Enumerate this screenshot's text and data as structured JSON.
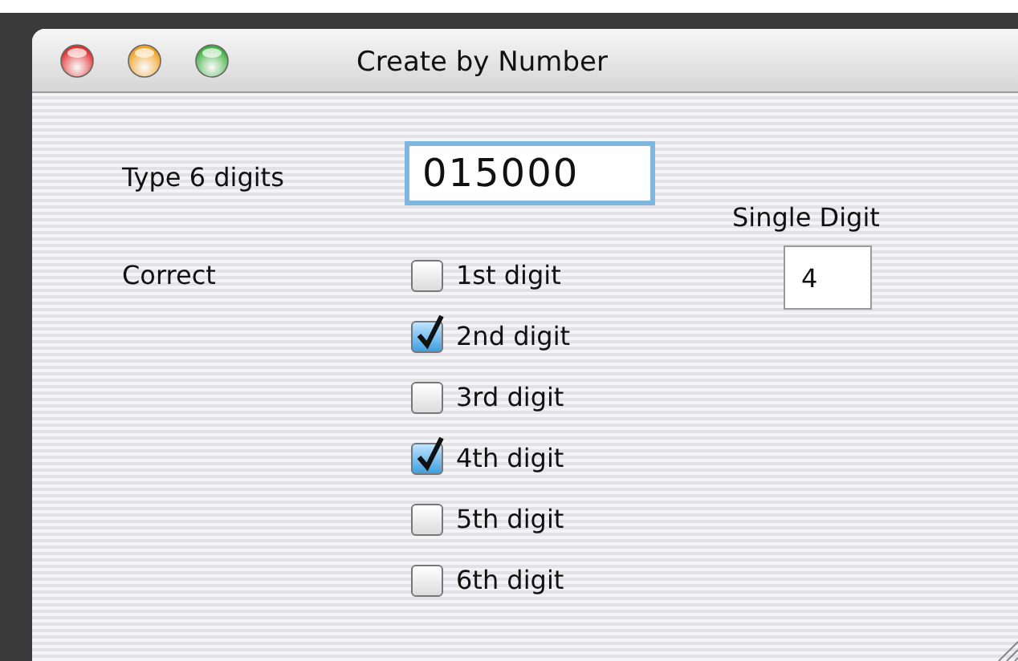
{
  "window": {
    "title": "Create by Number"
  },
  "digits_field": {
    "label": "Type 6 digits",
    "value": "015000"
  },
  "single_digit": {
    "label": "Single Digit",
    "value": "4"
  },
  "correct": {
    "label": "Correct",
    "options": [
      {
        "label": "1st digit",
        "checked": false
      },
      {
        "label": "2nd digit",
        "checked": true
      },
      {
        "label": "3rd digit",
        "checked": false
      },
      {
        "label": "4th digit",
        "checked": true
      },
      {
        "label": "5th digit",
        "checked": false
      },
      {
        "label": "6th digit",
        "checked": false
      }
    ]
  }
}
